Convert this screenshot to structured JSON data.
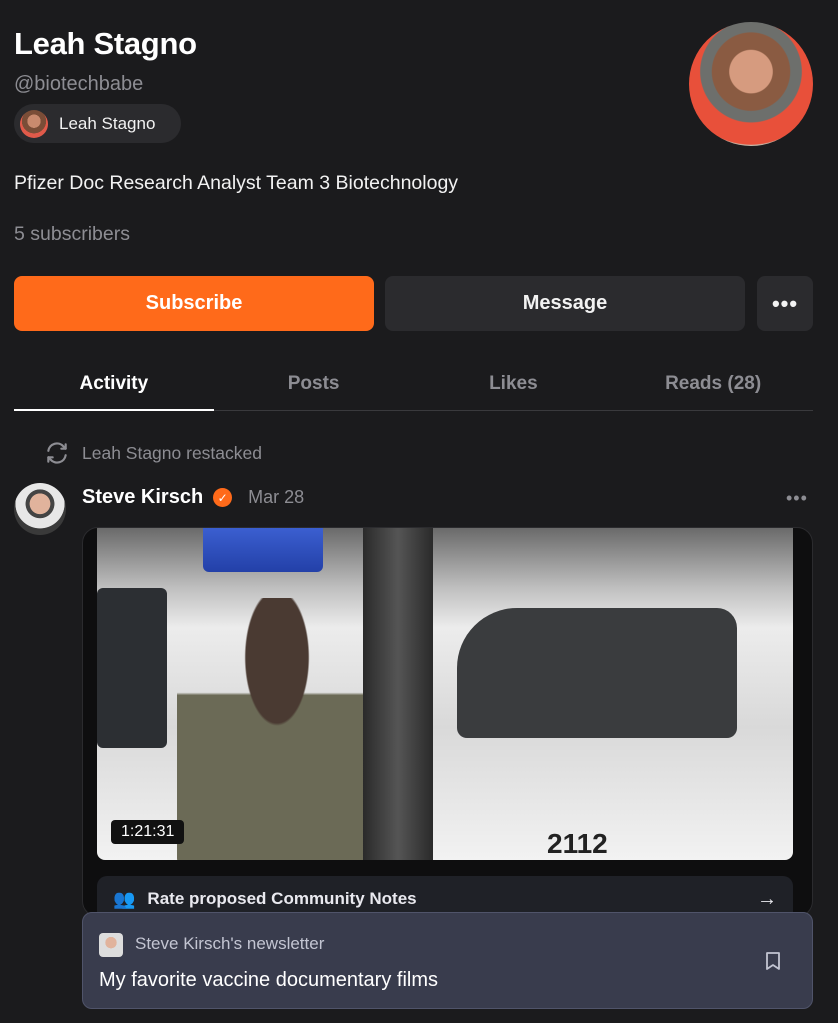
{
  "profile": {
    "name": "Leah Stagno",
    "handle": "@biotechbabe",
    "chip_label": "Leah Stagno",
    "bio": "Pfizer Doc Research Analyst Team 3 Biotechnology",
    "subscribers": "5 subscribers"
  },
  "actions": {
    "subscribe": "Subscribe",
    "message": "Message",
    "more": "•••"
  },
  "tabs": [
    {
      "label": "Activity",
      "active": true
    },
    {
      "label": "Posts",
      "active": false
    },
    {
      "label": "Likes",
      "active": false
    },
    {
      "label": "Reads (28)",
      "active": false
    }
  ],
  "feed": {
    "restack_text": "Leah Stagno restacked",
    "author": "Steve Kirsch",
    "date": "Mar 28",
    "more": "•••",
    "video": {
      "duration": "1:21:31",
      "plate": "2112"
    },
    "notes_label": "Rate proposed Community Notes",
    "notes_arrow": "→",
    "newsletter": {
      "name": "Steve Kirsch's newsletter",
      "title": "My favorite vaccine documentary films"
    }
  },
  "colors": {
    "accent": "#ff6a1a",
    "background": "#1b1b1d",
    "muted_text": "#8d8d93"
  }
}
